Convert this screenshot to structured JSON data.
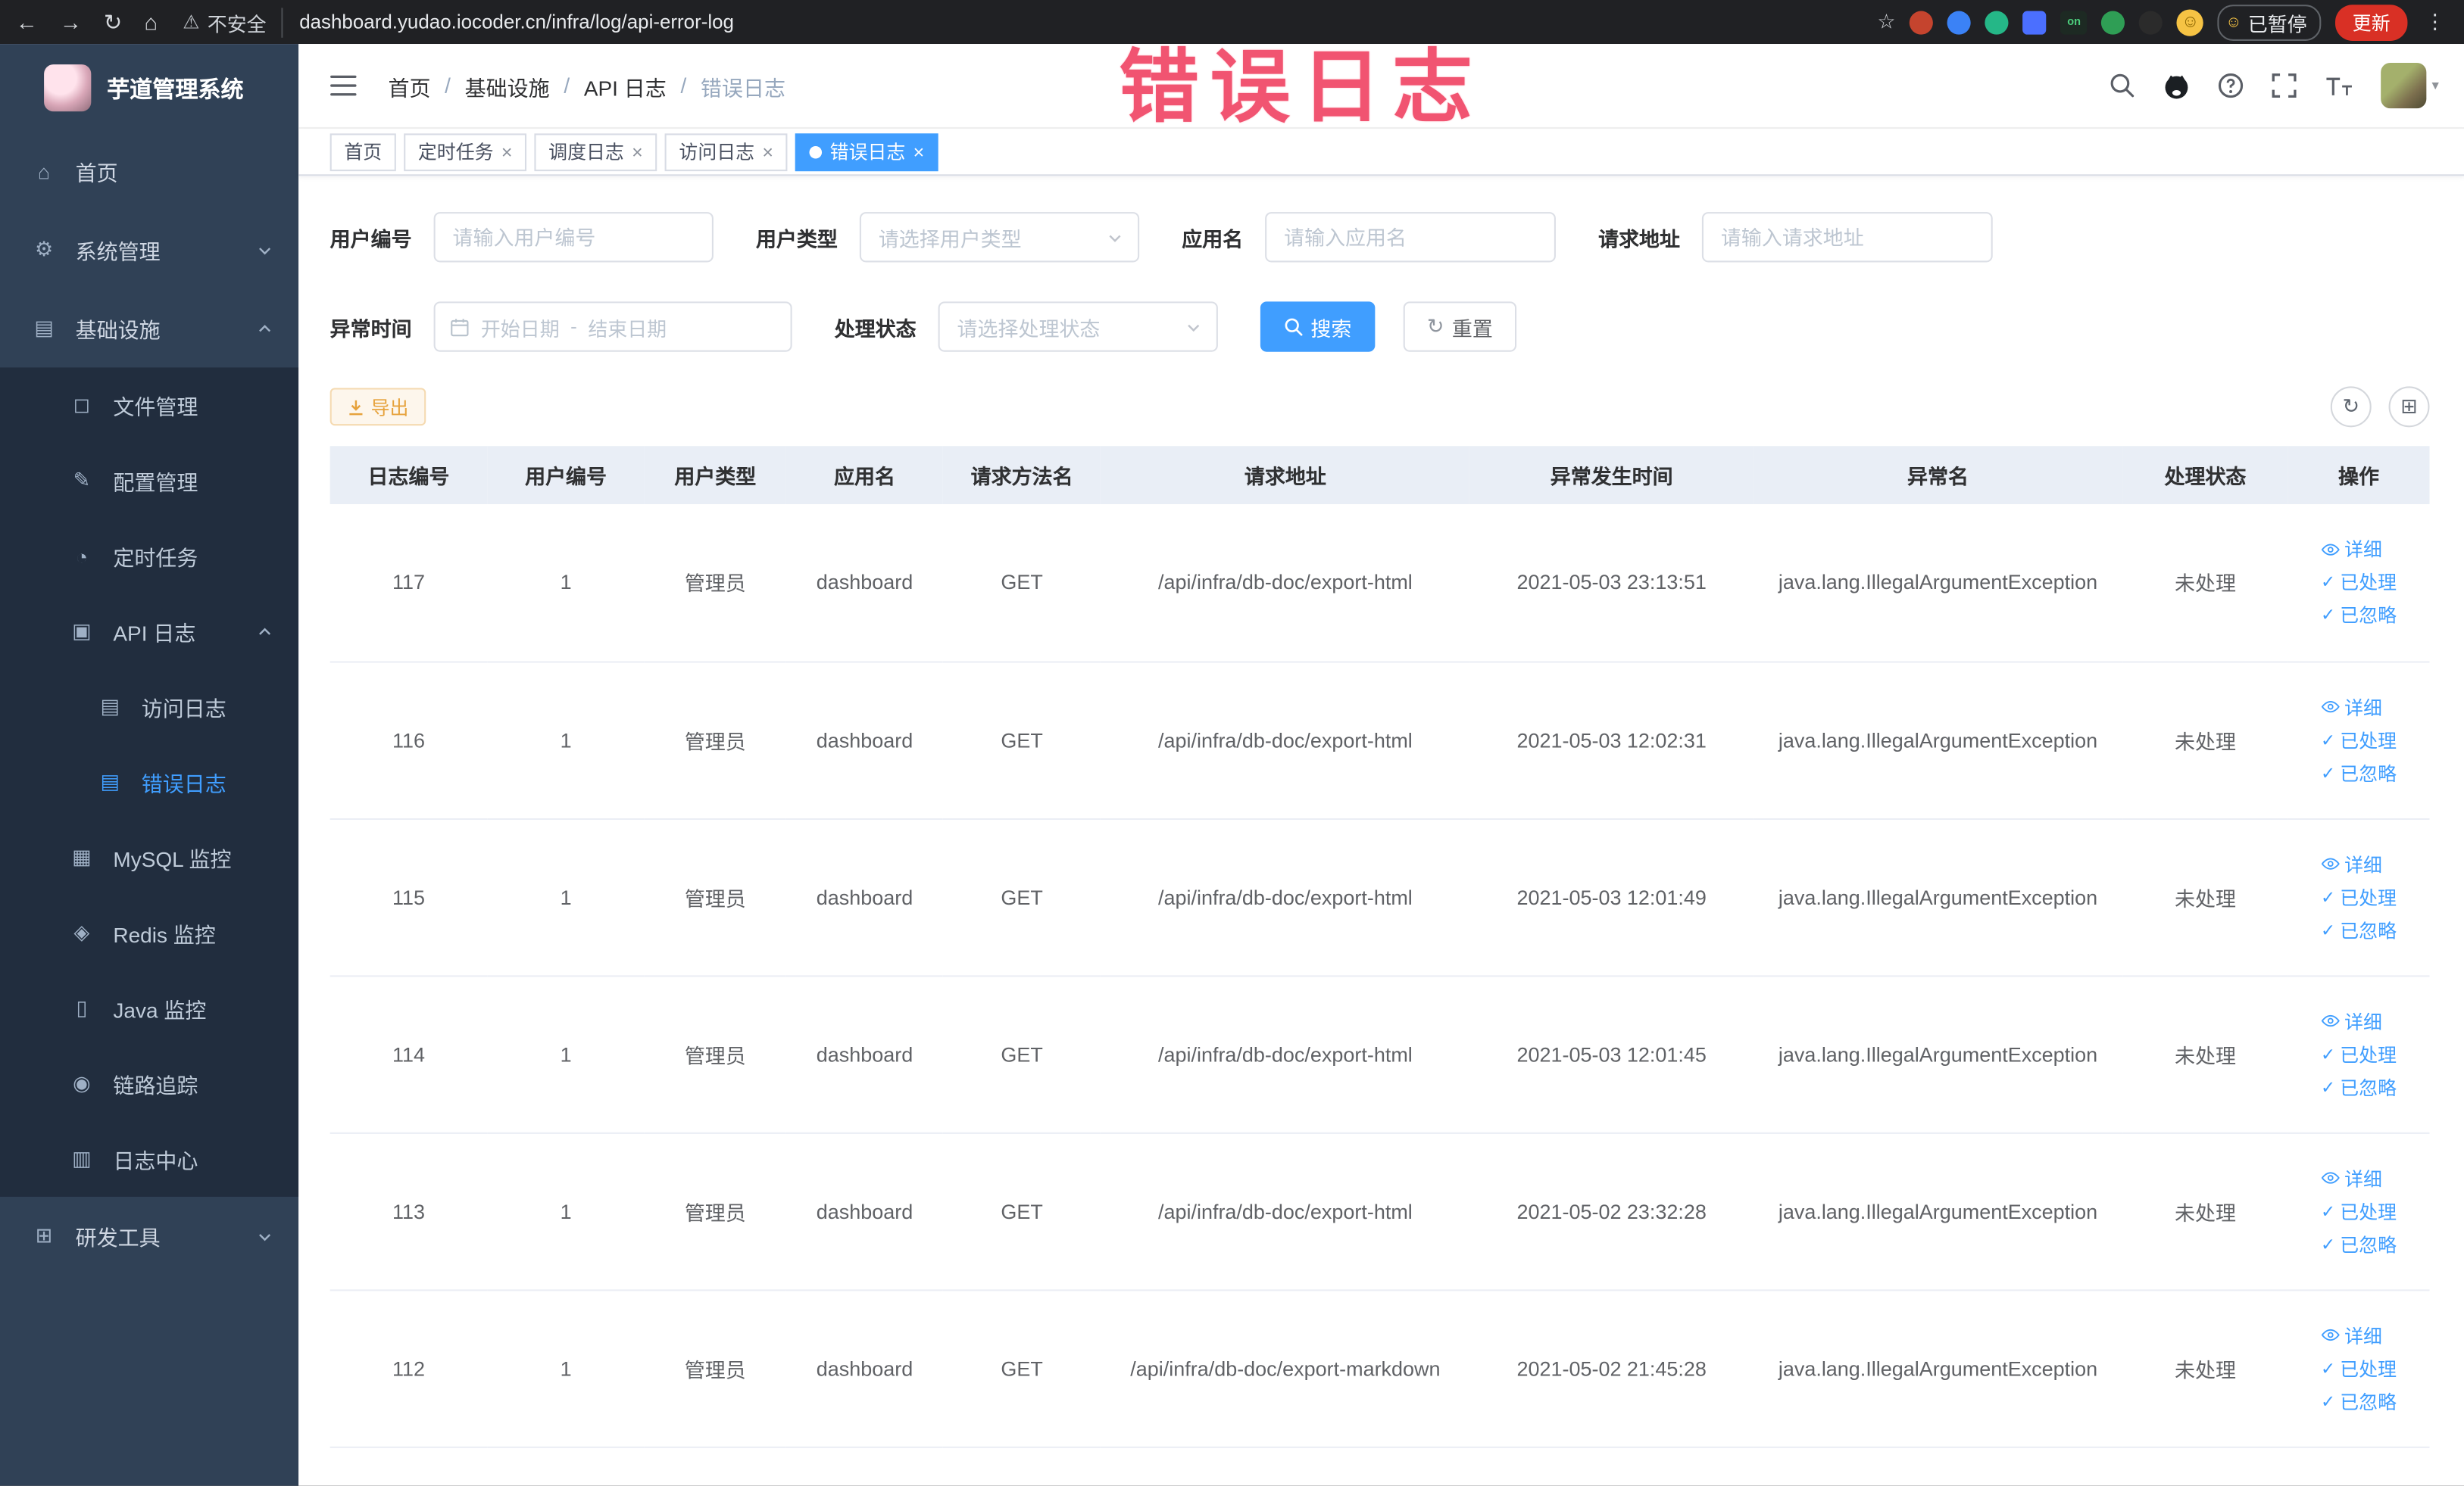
{
  "browser": {
    "security_label": "不安全",
    "url": "dashboard.yudao.iocoder.cn/infra/log/api-error-log",
    "ext_on_label": "on",
    "paused_badge": "已暂停",
    "update_button": "更新"
  },
  "annotation": {
    "text": "错误日志"
  },
  "ui": {
    "close_glyph": "×",
    "breadcrumb_separator": "/",
    "date_separator": "-"
  },
  "icons": {
    "back": "←",
    "forward": "→",
    "reload": "↻",
    "home": "⌂",
    "warning": "⚠",
    "star": "☆",
    "kebab": "⋮",
    "smiley": "☺",
    "menu_home": "⌂",
    "menu_system": "⚙",
    "menu_infra": "▤",
    "menu_file": "◻",
    "menu_config": "✎",
    "menu_cron": "◔",
    "menu_api_log": "▣",
    "menu_doc": "▤",
    "menu_mysql": "▦",
    "menu_redis": "◈",
    "menu_java": "▯",
    "menu_trace": "◉",
    "menu_log_center": "▥",
    "menu_dev": "⊞",
    "reset": "↻",
    "refresh": "↻",
    "columns": "⊞",
    "check": "✓",
    "caret_down": "▾"
  },
  "sidebar": {
    "logo_title": "芋道管理系统",
    "items": [
      {
        "label": "首页"
      },
      {
        "label": "系统管理"
      },
      {
        "label": "基础设施",
        "children": [
          {
            "label": "文件管理"
          },
          {
            "label": "配置管理"
          },
          {
            "label": "定时任务"
          },
          {
            "label": "API 日志",
            "children": [
              {
                "label": "访问日志"
              },
              {
                "label": "错误日志"
              }
            ]
          },
          {
            "label": "MySQL 监控"
          },
          {
            "label": "Redis 监控"
          },
          {
            "label": "Java 监控"
          },
          {
            "label": "链路追踪"
          },
          {
            "label": "日志中心"
          }
        ]
      },
      {
        "label": "研发工具"
      }
    ]
  },
  "header": {
    "breadcrumbs": [
      "首页",
      "基础设施",
      "API 日志",
      "错误日志"
    ]
  },
  "tabs": [
    {
      "label": "首页"
    },
    {
      "label": "定时任务"
    },
    {
      "label": "调度日志"
    },
    {
      "label": "访问日志"
    },
    {
      "label": "错误日志"
    }
  ],
  "filters": {
    "user_id": {
      "label": "用户编号",
      "placeholder": "请输入用户编号"
    },
    "user_type": {
      "label": "用户类型",
      "placeholder": "请选择用户类型"
    },
    "app_name": {
      "label": "应用名",
      "placeholder": "请输入应用名"
    },
    "request_url": {
      "label": "请求地址",
      "placeholder": "请输入请求地址"
    },
    "exception_time": {
      "label": "异常时间",
      "start_placeholder": "开始日期",
      "end_placeholder": "结束日期"
    },
    "process_status": {
      "label": "处理状态",
      "placeholder": "请选择处理状态"
    },
    "search_button": "搜索",
    "reset_button": "重置"
  },
  "toolbar": {
    "export_button": "导出"
  },
  "table": {
    "columns": [
      "日志编号",
      "用户编号",
      "用户类型",
      "应用名",
      "请求方法名",
      "请求地址",
      "异常发生时间",
      "异常名",
      "处理状态",
      "操作"
    ],
    "row_actions": [
      "详细",
      "已处理",
      "已忽略"
    ],
    "rows": [
      {
        "id": "117",
        "user_id": "1",
        "user_type": "管理员",
        "app": "dashboard",
        "method": "GET",
        "url": "/api/infra/db-doc/export-html",
        "time": "2021-05-03 23:13:51",
        "exception": "java.lang.IllegalArgumentException",
        "status": "未处理"
      },
      {
        "id": "116",
        "user_id": "1",
        "user_type": "管理员",
        "app": "dashboard",
        "method": "GET",
        "url": "/api/infra/db-doc/export-html",
        "time": "2021-05-03 12:02:31",
        "exception": "java.lang.IllegalArgumentException",
        "status": "未处理"
      },
      {
        "id": "115",
        "user_id": "1",
        "user_type": "管理员",
        "app": "dashboard",
        "method": "GET",
        "url": "/api/infra/db-doc/export-html",
        "time": "2021-05-03 12:01:49",
        "exception": "java.lang.IllegalArgumentException",
        "status": "未处理"
      },
      {
        "id": "114",
        "user_id": "1",
        "user_type": "管理员",
        "app": "dashboard",
        "method": "GET",
        "url": "/api/infra/db-doc/export-html",
        "time": "2021-05-03 12:01:45",
        "exception": "java.lang.IllegalArgumentException",
        "status": "未处理"
      },
      {
        "id": "113",
        "user_id": "1",
        "user_type": "管理员",
        "app": "dashboard",
        "method": "GET",
        "url": "/api/infra/db-doc/export-html",
        "time": "2021-05-02 23:32:28",
        "exception": "java.lang.IllegalArgumentException",
        "status": "未处理"
      },
      {
        "id": "112",
        "user_id": "1",
        "user_type": "管理员",
        "app": "dashboard",
        "method": "GET",
        "url": "/api/infra/db-doc/export-markdown",
        "time": "2021-05-02 21:45:28",
        "exception": "java.lang.IllegalArgumentException",
        "status": "未处理"
      }
    ]
  }
}
